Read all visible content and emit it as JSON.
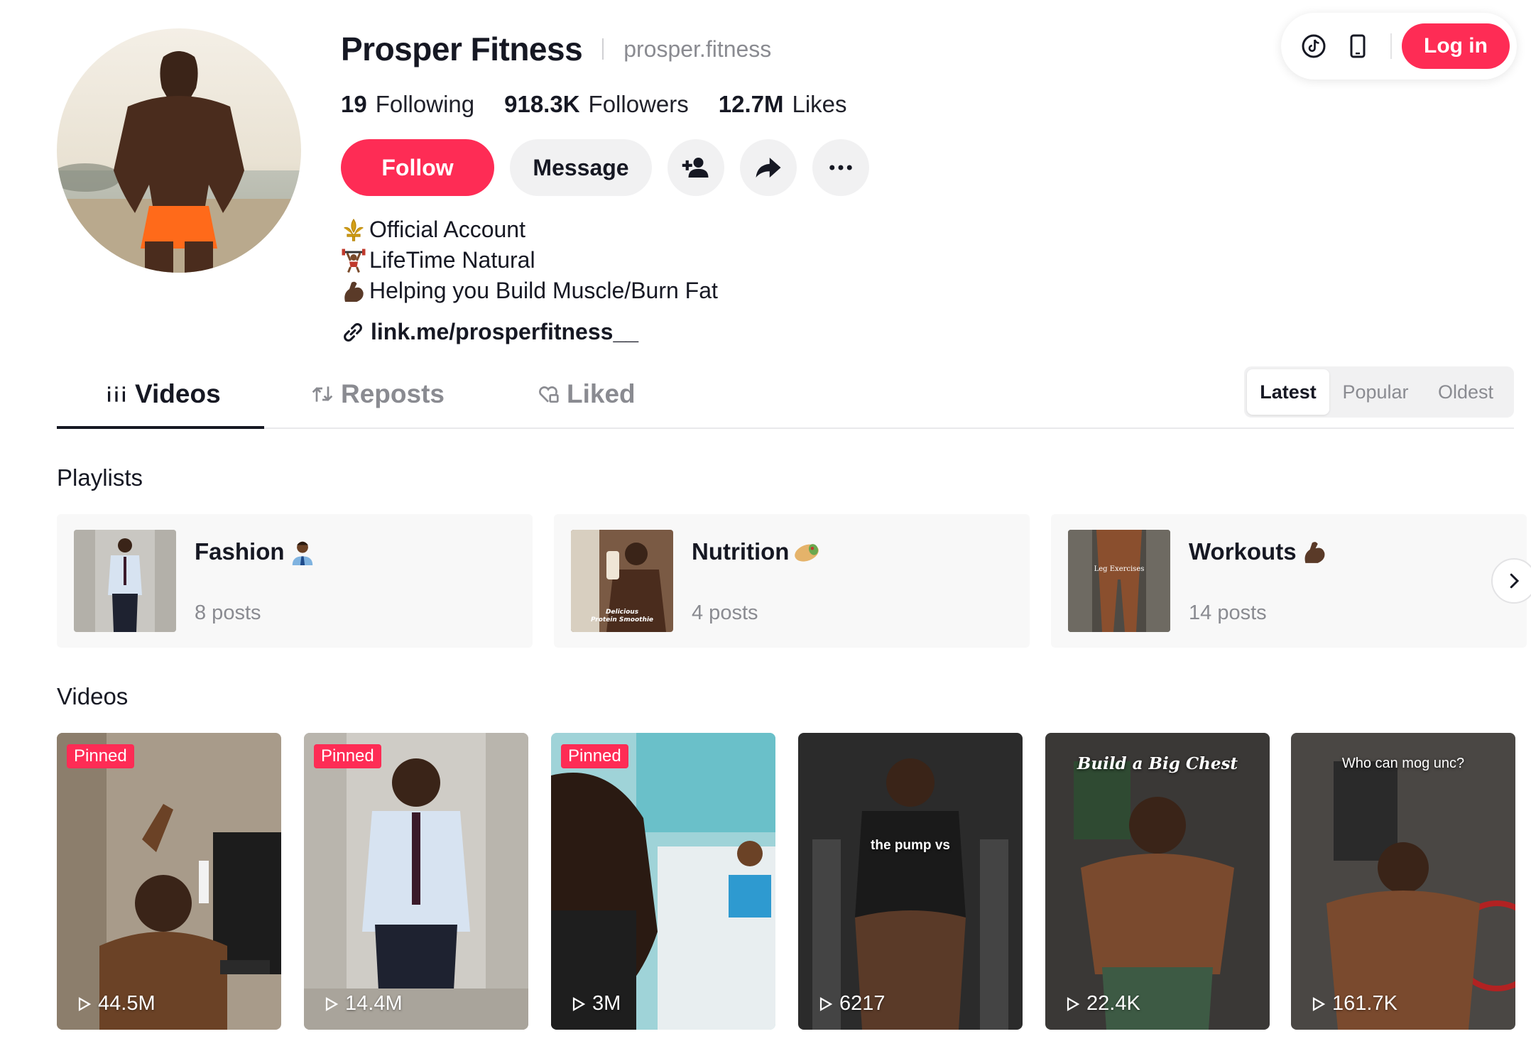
{
  "profile": {
    "name": "Prosper Fitness",
    "handle": "prosper.fitness",
    "stats": [
      {
        "value": "19",
        "label": "Following"
      },
      {
        "value": "918.3K",
        "label": "Followers"
      },
      {
        "value": "12.7M",
        "label": "Likes"
      }
    ],
    "follow_label": "Follow",
    "message_label": "Message",
    "bio": [
      {
        "emoji": "fleur-de-lis",
        "text": "Official Account"
      },
      {
        "emoji": "weightlifter",
        "text": "LifeTime Natural"
      },
      {
        "emoji": "flexed-biceps",
        "text": "Helping you Build Muscle/Burn Fat"
      }
    ],
    "link": "link.me/prosperfitness__"
  },
  "top_bar": {
    "login_label": "Log in",
    "icons": [
      "tiktok-icon",
      "phone-icon"
    ]
  },
  "tabs": [
    {
      "label": "Videos",
      "icon": "grid-icon",
      "active": true
    },
    {
      "label": "Reposts",
      "icon": "repost-icon",
      "active": false
    },
    {
      "label": "Liked",
      "icon": "heart-lock-icon",
      "active": false
    }
  ],
  "sort": [
    {
      "label": "Latest",
      "active": true
    },
    {
      "label": "Popular",
      "active": false
    },
    {
      "label": "Oldest",
      "active": false
    }
  ],
  "playlists": {
    "title": "Playlists",
    "items": [
      {
        "title": "Fashion",
        "emoji": "man-office-worker",
        "count": "8 posts"
      },
      {
        "title": "Nutrition",
        "emoji": "burrito",
        "count": "4 posts",
        "thumb_text": "Delicious Protein Smoothie"
      },
      {
        "title": "Workouts",
        "emoji": "flexed-biceps",
        "count": "14 posts",
        "thumb_text": "Leg Exercises"
      }
    ]
  },
  "videos": {
    "title": "Videos",
    "items": [
      {
        "views": "44.5M",
        "pinned": "Pinned"
      },
      {
        "views": "14.4M",
        "pinned": "Pinned"
      },
      {
        "views": "3M",
        "pinned": "Pinned"
      },
      {
        "views": "6217",
        "overlay": "the pump vs"
      },
      {
        "views": "22.4K",
        "overlay": "Build a Big Chest"
      },
      {
        "views": "161.7K",
        "overlay": "Who can mog unc?"
      }
    ]
  },
  "colors": {
    "accent": "#fe2c55",
    "text": "#161823",
    "muted": "#8a8b91"
  }
}
